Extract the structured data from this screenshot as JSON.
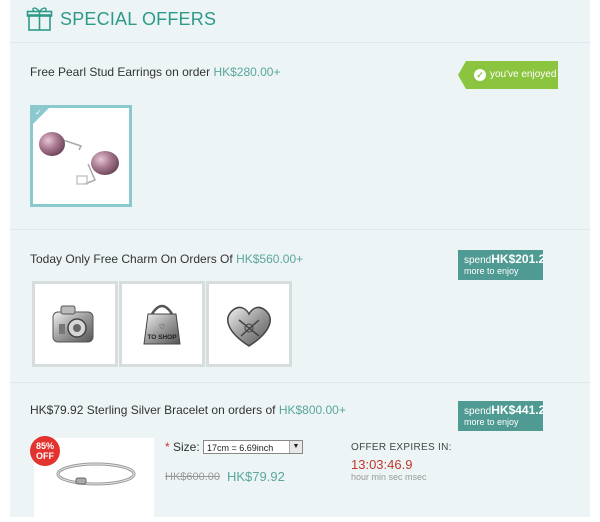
{
  "header": {
    "title": "SPECIAL OFFERS",
    "icon": "gift-icon"
  },
  "colors": {
    "accent": "#2e9a88",
    "price": "#5aa69b",
    "enjoyed_tag": "#8bc43f",
    "spend_tag": "#4f9b93",
    "discount": "#e2332e",
    "countdown": "#c0392b"
  },
  "offers": [
    {
      "title_prefix": "Free Pearl Stud Earrings on order",
      "threshold": "HK$280.00+",
      "tag": {
        "text": "you've enjoyed",
        "icon": "check-circle-icon"
      },
      "products": [
        "pearl-stud-earrings"
      ]
    },
    {
      "title_prefix": "Today Only Free Charm On Orders Of",
      "threshold": "HK$560.00+",
      "tag": {
        "prefix": "spend",
        "amount": "HK$201.2",
        "suffix": "more to enjoy"
      },
      "products": [
        "camera-charm",
        "to-shop-bag-charm",
        "heart-charm"
      ],
      "charm_text": "TO SHOP"
    },
    {
      "title_prefix": "HK$79.92 Sterling Silver Bracelet on orders of",
      "threshold": "HK$800.00+",
      "tag": {
        "prefix": "spend",
        "amount": "HK$441.2",
        "suffix": "more to enjoy"
      },
      "badge": {
        "line1": "85%",
        "line2": "OFF"
      },
      "size": {
        "label": "Size:",
        "required_mark": "*",
        "selected": "17cm = 6.69inch"
      },
      "old_price": "HK$600.00",
      "new_price": "HK$79.92",
      "expires_label": "OFFER EXPIRES IN:",
      "countdown": "13:03:46.9",
      "countdown_units": "hour min sec msec"
    }
  ]
}
